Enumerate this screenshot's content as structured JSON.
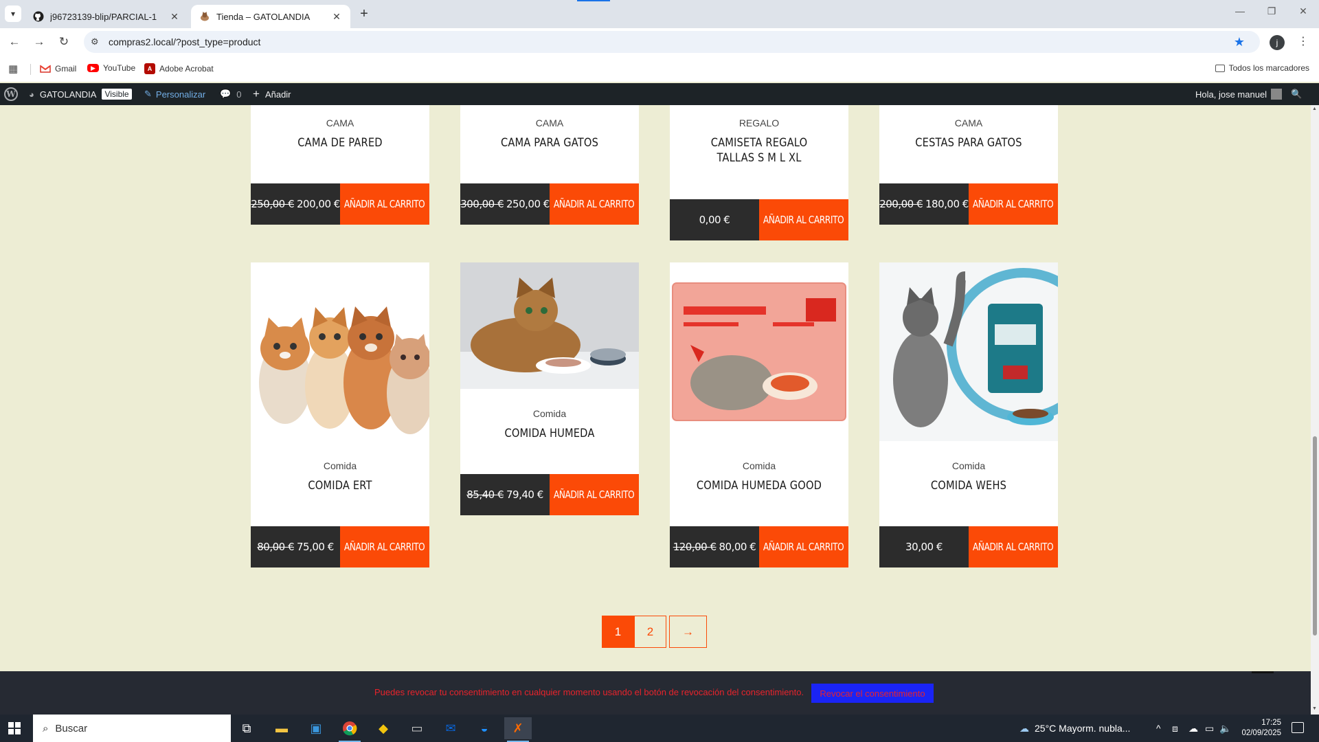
{
  "browser": {
    "tabs": [
      {
        "title": "j96723139-blip/PARCIAL-1",
        "icon": "github-icon"
      },
      {
        "title": "Tienda – GATOLANDIA",
        "icon": "cat-favicon"
      }
    ],
    "url": "compras2.local/?post_type=product",
    "bookmarks": [
      {
        "label": "Gmail",
        "icon": "gmail-icon"
      },
      {
        "label": "YouTube",
        "icon": "youtube-icon"
      },
      {
        "label": "Adobe Acrobat",
        "icon": "acrobat-icon"
      }
    ],
    "all_bookmarks": "Todos los marcadores",
    "profile_initial": "j"
  },
  "adminbar": {
    "site_name": "GATOLANDIA",
    "visible_badge": "Visible",
    "customize": "Personalizar",
    "comments_count": "0",
    "new": "Añadir",
    "greeting": "Hola, jose manuel"
  },
  "shop": {
    "add_to_cart": "AÑADIR AL CARRITO",
    "products": [
      {
        "category": "CAMA",
        "name": "CAMA DE PARED",
        "old_price": "250,00 €",
        "price": "200,00 €"
      },
      {
        "category": "CAMA",
        "name": "CAMA PARA GATOS",
        "old_price": "300,00 €",
        "price": "250,00 €"
      },
      {
        "category": "REGALO",
        "name": "CAMISETA REGALO TALLAS S M L XL",
        "old_price": "",
        "price": "0,00 €"
      },
      {
        "category": "CAMA",
        "name": "CESTAS PARA GATOS",
        "old_price": "200,00 €",
        "price": "180,00 €"
      },
      {
        "category": "Comida",
        "name": "COMIDA ERT",
        "old_price": "80,00 €",
        "price": "75,00 €",
        "image": "kittens-photo"
      },
      {
        "category": "Comida",
        "name": "COMIDA HUMEDA",
        "old_price": "85,40 €",
        "price": "79,40 €",
        "image": "cat-with-can-photo"
      },
      {
        "category": "Comida",
        "name": "COMIDA HUMEDA GOOD",
        "old_price": "120,00 €",
        "price": "80,00 €",
        "image": "emince-pack-photo"
      },
      {
        "category": "Comida",
        "name": "COMIDA WEHS",
        "old_price": "",
        "price": "30,00 €",
        "image": "purina-one-photo"
      }
    ],
    "pagination": [
      "1",
      "2",
      "→"
    ],
    "current_page": "1",
    "accent_color": "#fb4a07"
  },
  "consent": {
    "message": "Puedes revocar tu consentimiento en cualquier momento usando el botón de revocación del consentimiento.",
    "button": "Revocar el consentimiento"
  },
  "taskbar": {
    "search_placeholder": "Buscar",
    "weather": "25°C  Mayorm. nubla...",
    "time": "17:25",
    "date": "02/09/2025"
  }
}
